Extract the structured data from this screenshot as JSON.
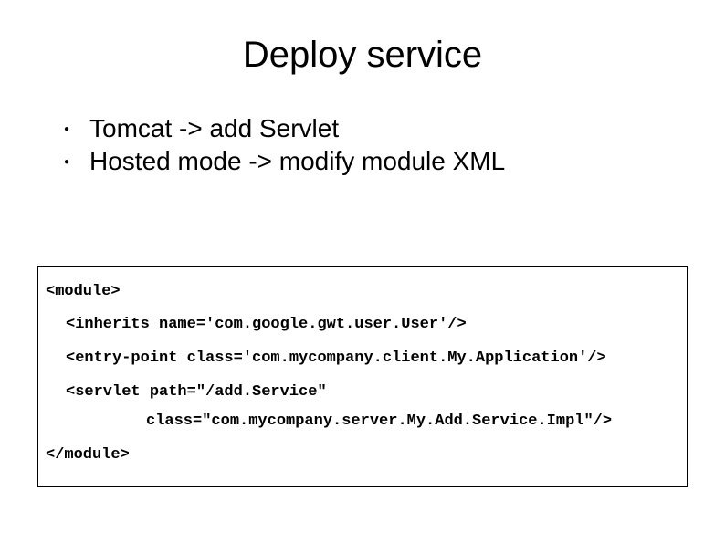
{
  "slide": {
    "title": "Deploy service",
    "bullets": [
      "Tomcat -> add Servlet",
      "Hosted mode -> modify module XML"
    ],
    "code": {
      "line1": "<module>",
      "line2": "<inherits name='com.google.gwt.user.User'/>",
      "line3": "<entry-point class='com.mycompany.client.My.Application'/>",
      "line4a": "<servlet path=\"/add.Service\"",
      "line4b": "class=\"com.mycompany.server.My.Add.Service.Impl\"/>",
      "line5": "</module>"
    }
  }
}
